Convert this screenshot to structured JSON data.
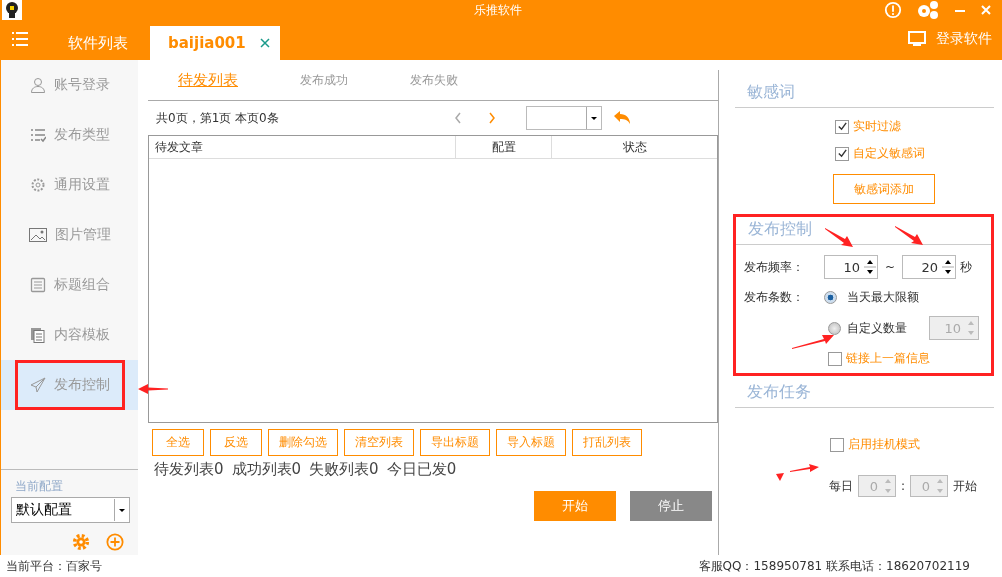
{
  "window": {
    "title": "乐推软件"
  },
  "tabs": [
    {
      "label": "软件列表",
      "selected": false
    },
    {
      "label": "baijia001",
      "selected": true
    }
  ],
  "login": "登录软件",
  "sidebar": {
    "items": [
      {
        "label": "账号登录",
        "selected": false,
        "highlighted": false
      },
      {
        "label": "发布类型",
        "selected": false,
        "highlighted": false
      },
      {
        "label": "通用设置",
        "selected": false,
        "highlighted": false
      },
      {
        "label": "图片管理",
        "selected": false,
        "highlighted": false
      },
      {
        "label": "标题组合",
        "selected": false,
        "highlighted": false
      },
      {
        "label": "内容模板",
        "selected": false,
        "highlighted": false
      },
      {
        "label": "发布控制",
        "selected": true,
        "highlighted": true
      }
    ],
    "config_label": "当前配置",
    "config_value": "默认配置"
  },
  "list_tabs": [
    {
      "label": "待发列表",
      "selected": true
    },
    {
      "label": "发布成功",
      "selected": false
    },
    {
      "label": "发布失败",
      "selected": false
    }
  ],
  "page_info": "共0页，第1页 本页0条",
  "table": {
    "columns": [
      "待发文章",
      "配置",
      "状态"
    ]
  },
  "actions": [
    "全选",
    "反选",
    "删除勾选",
    "清空列表",
    "导出标题",
    "导入标题",
    "打乱列表"
  ],
  "counts": [
    "待发列表0",
    "成功列表0",
    "失败列表0",
    "今日已发0"
  ],
  "start": "开始",
  "stop": "停止",
  "sensitive": {
    "title": "敏感词",
    "options": [
      {
        "label": "实时过滤",
        "checked": true
      },
      {
        "label": "自定义敏感词",
        "checked": true
      }
    ],
    "button": "敏感词添加"
  },
  "control": {
    "title": "发布控制",
    "highlighted": true,
    "freq_label": "发布频率：",
    "from": "10",
    "sep": "~",
    "to": "20",
    "unit": "秒",
    "count_label": "发布条数：",
    "radios": [
      {
        "label": "当天最大限额",
        "selected": true
      },
      {
        "label": "自定义数量",
        "selected": false
      }
    ],
    "custom": {
      "value": "10",
      "disabled": true
    },
    "link": {
      "label": "链接上一篇信息",
      "checked": false
    }
  },
  "task": {
    "title": "发布任务",
    "option": {
      "label": "启用挂机模式",
      "checked": false
    },
    "daily": "每日",
    "hour": {
      "value": "0",
      "disabled": true
    },
    "colon": ":",
    "minute": {
      "value": "0",
      "disabled": true
    },
    "start": "开始"
  },
  "status_bar": {
    "platform": "当前平台：百家号",
    "contact": "客服QQ：158950781  联系电话：18620702119"
  }
}
